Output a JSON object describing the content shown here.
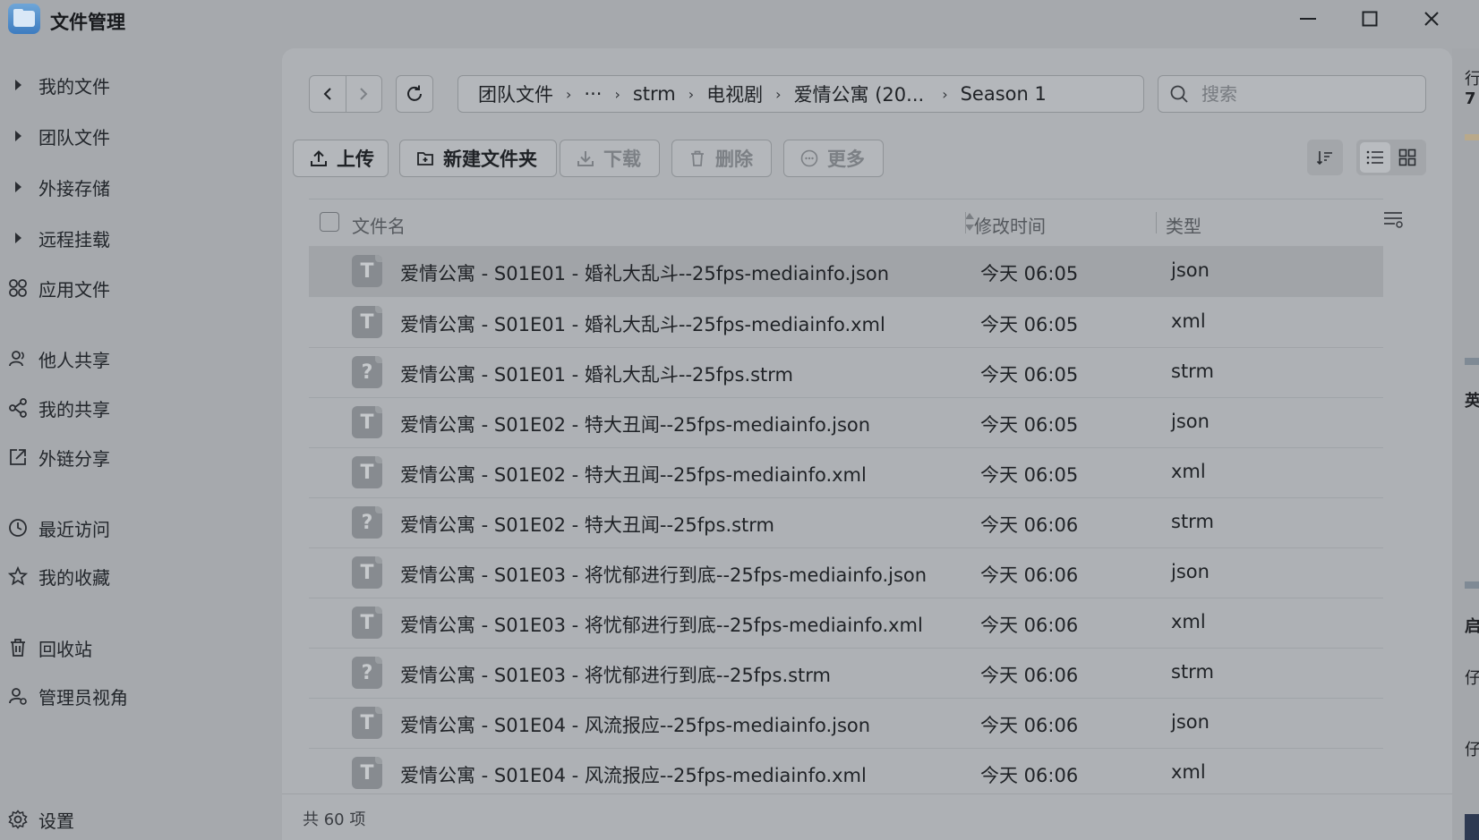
{
  "app": {
    "title": "文件管理"
  },
  "window": {
    "minimize": "—",
    "maximize": "☐",
    "close": "✕"
  },
  "sidebar": {
    "items": [
      {
        "label": "我的文件",
        "icon": "caret-right-icon"
      },
      {
        "label": "团队文件",
        "icon": "caret-right-icon"
      },
      {
        "label": "外接存储",
        "icon": "caret-right-icon"
      },
      {
        "label": "远程挂载",
        "icon": "caret-right-icon"
      },
      {
        "label": "应用文件",
        "icon": "apps-icon"
      },
      {
        "label": "他人共享",
        "icon": "users-icon"
      },
      {
        "label": "我的共享",
        "icon": "share-icon"
      },
      {
        "label": "外链分享",
        "icon": "external-link-icon"
      },
      {
        "label": "最近访问",
        "icon": "clock-icon"
      },
      {
        "label": "我的收藏",
        "icon": "star-icon"
      },
      {
        "label": "回收站",
        "icon": "trash-icon"
      },
      {
        "label": "管理员视角",
        "icon": "admin-icon"
      }
    ],
    "settings": "设置"
  },
  "breadcrumb": [
    "团队文件",
    "···",
    "strm",
    "电视剧",
    "爱情公寓 (20...",
    "Season 1"
  ],
  "search": {
    "placeholder": "搜索"
  },
  "actions": {
    "upload": "上传",
    "new_folder": "新建文件夹",
    "download": "下载",
    "delete": "删除",
    "more": "更多"
  },
  "table": {
    "headers": {
      "name": "文件名",
      "modified": "修改时间",
      "type": "类型"
    },
    "rows": [
      {
        "icon": "T",
        "name": "爱情公寓 - S01E01 - 婚礼大乱斗--25fps-mediainfo.json",
        "time": "今天 06:05",
        "type": "json"
      },
      {
        "icon": "T",
        "name": "爱情公寓 - S01E01 - 婚礼大乱斗--25fps-mediainfo.xml",
        "time": "今天 06:05",
        "type": "xml"
      },
      {
        "icon": "?",
        "name": "爱情公寓 - S01E01 - 婚礼大乱斗--25fps.strm",
        "time": "今天 06:05",
        "type": "strm"
      },
      {
        "icon": "T",
        "name": "爱情公寓 - S01E02 - 特大丑闻--25fps-mediainfo.json",
        "time": "今天 06:05",
        "type": "json"
      },
      {
        "icon": "T",
        "name": "爱情公寓 - S01E02 - 特大丑闻--25fps-mediainfo.xml",
        "time": "今天 06:05",
        "type": "xml"
      },
      {
        "icon": "?",
        "name": "爱情公寓 - S01E02 - 特大丑闻--25fps.strm",
        "time": "今天 06:06",
        "type": "strm"
      },
      {
        "icon": "T",
        "name": "爱情公寓 - S01E03 - 将忧郁进行到底--25fps-mediainfo.json",
        "time": "今天 06:06",
        "type": "json"
      },
      {
        "icon": "T",
        "name": "爱情公寓 - S01E03 - 将忧郁进行到底--25fps-mediainfo.xml",
        "time": "今天 06:06",
        "type": "xml"
      },
      {
        "icon": "?",
        "name": "爱情公寓 - S01E03 - 将忧郁进行到底--25fps.strm",
        "time": "今天 06:06",
        "type": "strm"
      },
      {
        "icon": "T",
        "name": "爱情公寓 - S01E04 - 风流报应--25fps-mediainfo.json",
        "time": "今天 06:06",
        "type": "json"
      },
      {
        "icon": "T",
        "name": "爱情公寓 - S01E04 - 风流报应--25fps-mediainfo.xml",
        "time": "今天 06:06",
        "type": "xml"
      }
    ]
  },
  "footer": {
    "count": "共 60 项"
  },
  "background_window": {
    "texts": [
      "行",
      "7",
      "英",
      "启",
      "仔",
      "仔"
    ]
  }
}
